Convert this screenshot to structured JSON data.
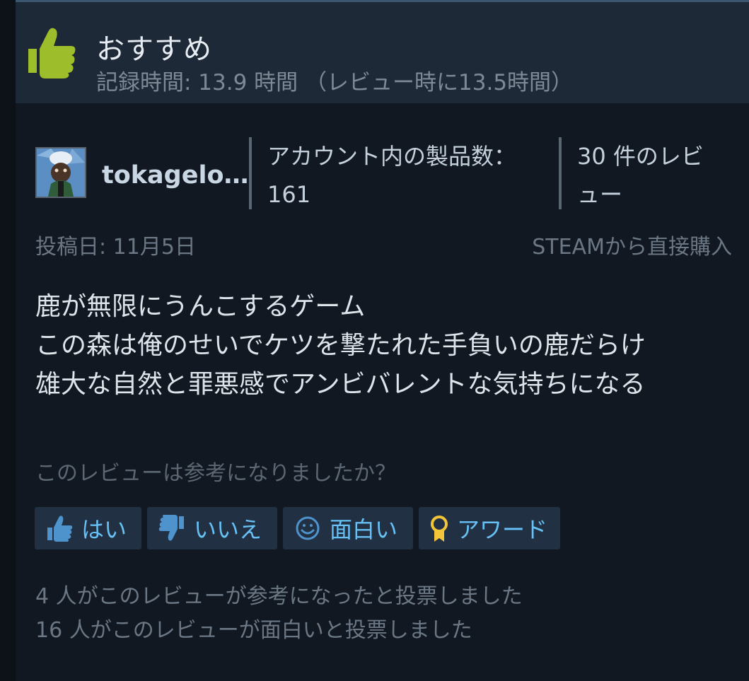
{
  "header": {
    "recommendation": "おすすめ",
    "hours": "記録時間: 13.9 時間 （レビュー時に13.5時間）"
  },
  "author": {
    "username": "tokagelo…",
    "products_label": "アカウント内の製品数：",
    "products_count": "161",
    "reviews_line1": "30 件のレビ",
    "reviews_line2": "ュー"
  },
  "meta": {
    "posted": "投稿日: 11月5日",
    "source": "STEAMから直接購入"
  },
  "review": {
    "lines": [
      "鹿が無限にうんこするゲーム",
      "この森は俺のせいでケツを撃たれた手負いの鹿だらけ",
      "雄大な自然と罪悪感でアンビバレントな気持ちになる"
    ]
  },
  "helpful": {
    "question": "このレビューは参考になりましたか？",
    "buttons": {
      "yes": "はい",
      "no": "いいえ",
      "funny": "面白い",
      "award": "アワード"
    },
    "helpful_votes": "4 人がこのレビューが参考になったと投票しました",
    "funny_votes": "16 人がこのレビューが面白いと投票しました"
  },
  "colors": {
    "thumb_green": "#9dbd2b",
    "link_blue": "#67c1f5",
    "award_gold": "#f2c43a"
  }
}
